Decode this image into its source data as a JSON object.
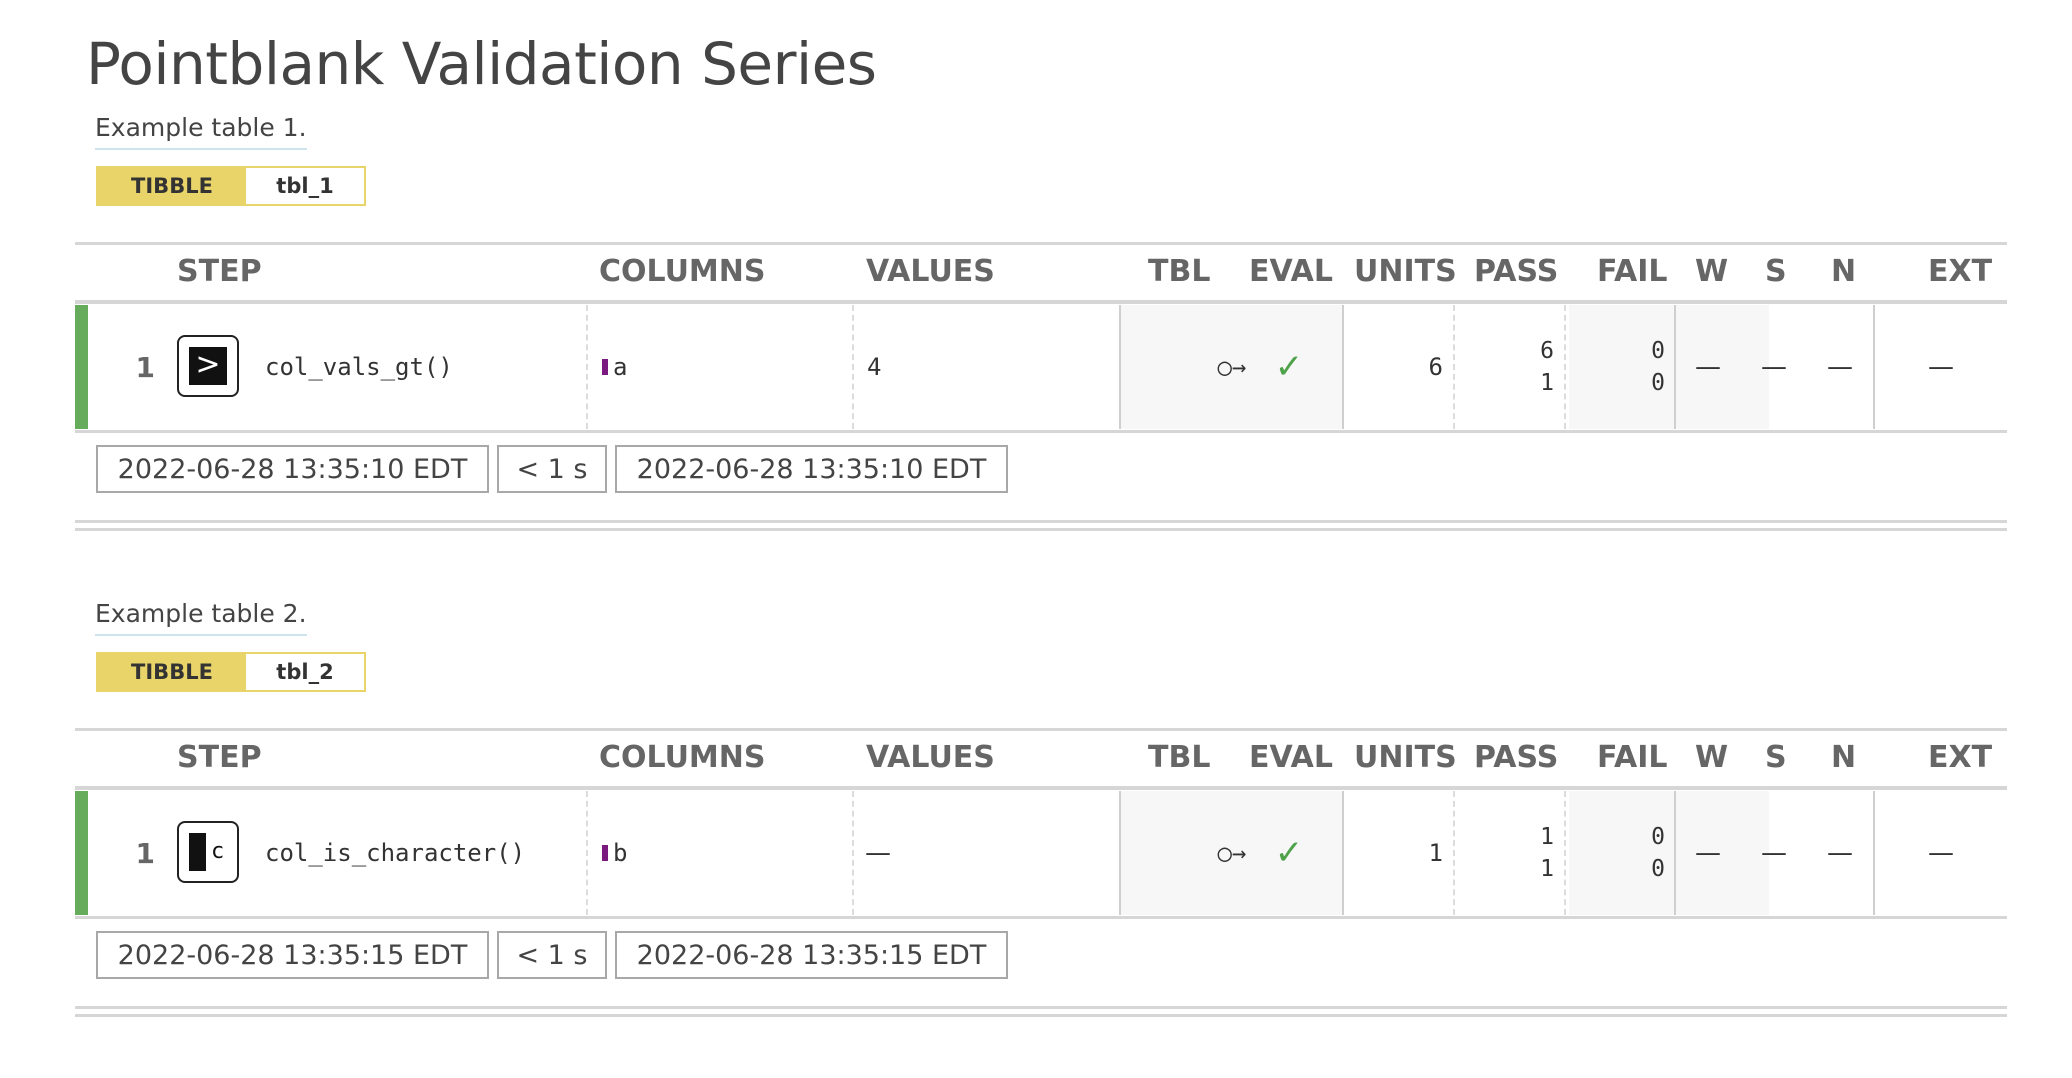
{
  "page_title": "Pointblank Validation Series",
  "column_headers": {
    "step": "STEP",
    "columns": "COLUMNS",
    "values": "VALUES",
    "tbl": "TBL",
    "eval": "EVAL",
    "units": "UNITS",
    "pass": "PASS",
    "fail": "FAIL",
    "w": "W",
    "s": "S",
    "n": "N",
    "ext": "EXT"
  },
  "colors": {
    "tbl_tag": "#e9d46a",
    "status_bar": "#67ab5c",
    "check": "#4ea24a",
    "column_marker": "#7a1a7e"
  },
  "tables": [
    {
      "caption": "Example table 1.",
      "tbl_type": "TIBBLE",
      "tbl_name": "tbl_1",
      "step": {
        "number": "1",
        "icon": "greater-than-icon",
        "icon_glyph": ">",
        "function": "col_vals_gt()",
        "column": "a",
        "value": "4",
        "tbl_icon": "○→",
        "eval": "✓",
        "units": "6",
        "pass_count": "6",
        "pass_fraction": "1",
        "fail_count": "0",
        "fail_fraction": "0",
        "w": "—",
        "s": "—",
        "n": "—",
        "ext": "—"
      },
      "time_start": "2022-06-28 13:35:10 EDT",
      "duration": "< 1 s",
      "time_end": "2022-06-28 13:35:10 EDT"
    },
    {
      "caption": "Example table 2.",
      "tbl_type": "TIBBLE",
      "tbl_name": "tbl_2",
      "step": {
        "number": "1",
        "icon": "character-type-icon",
        "icon_glyph": "c",
        "function": "col_is_character()",
        "column": "b",
        "value": "—",
        "tbl_icon": "○→",
        "eval": "✓",
        "units": "1",
        "pass_count": "1",
        "pass_fraction": "1",
        "fail_count": "0",
        "fail_fraction": "0",
        "w": "—",
        "s": "—",
        "n": "—",
        "ext": "—"
      },
      "time_start": "2022-06-28 13:35:15 EDT",
      "duration": "< 1 s",
      "time_end": "2022-06-28 13:35:15 EDT"
    }
  ]
}
